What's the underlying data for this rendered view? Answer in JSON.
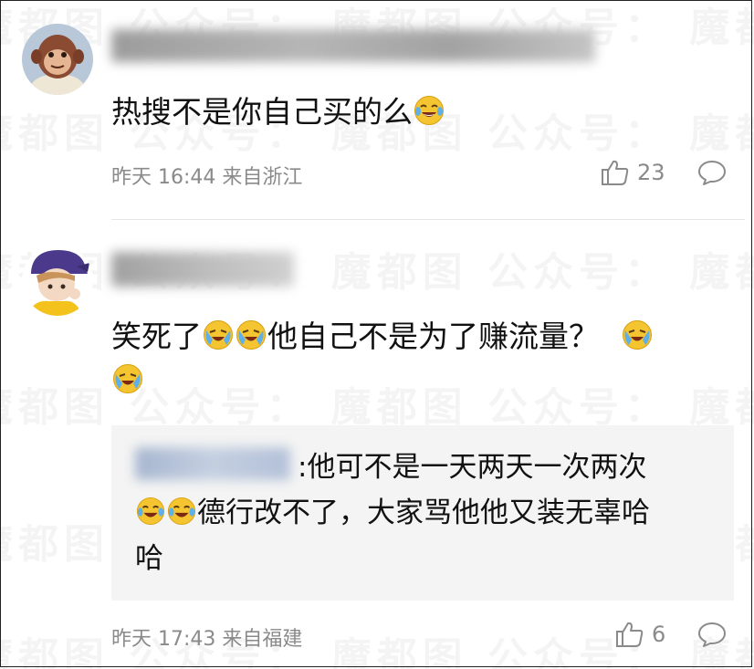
{
  "watermark": {
    "text": "魔都图 公众号："
  },
  "comments": [
    {
      "avatar": "avatar-monkey",
      "text": "热搜不是你自己买的么",
      "emoji": "laughing-tears-icon",
      "time": "昨天 16:44 来自浙江",
      "likes": "23"
    },
    {
      "avatar": "avatar-anime-boy",
      "text_a": "笑死了",
      "text_b": "他自己不是为了赚流量？",
      "time": "昨天 17:43 来自福建",
      "likes": "6",
      "reply": {
        "text_1": ":他可不是一天两天一次两次",
        "text_2": "德行改不了，大家骂他他又装无辜哈",
        "text_3": "哈"
      }
    }
  ],
  "colors": {
    "meta": "#8a8a8a",
    "text": "#111111",
    "reply_bg": "#f4f4f4",
    "emoji": "#f5c531"
  }
}
